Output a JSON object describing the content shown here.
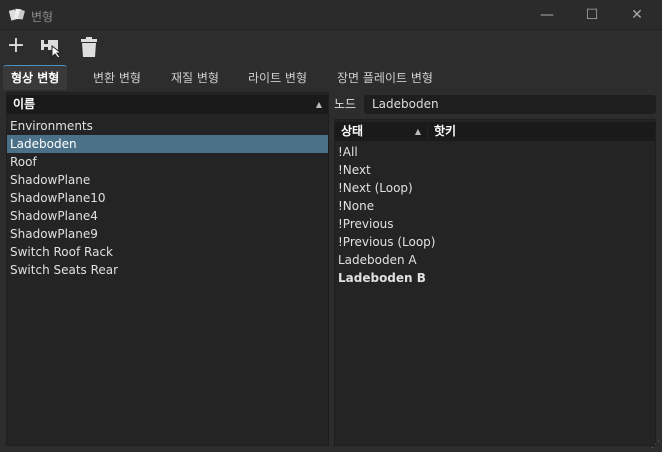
{
  "window": {
    "title": "변형",
    "minimize": "—",
    "maximize": "☐",
    "close": "✕"
  },
  "toolbar": {
    "add": "add-icon",
    "pick": "pick-node-icon",
    "delete": "trash-icon"
  },
  "tabs": [
    "형상 변형",
    "변환 변형",
    "재질 변형",
    "라이트 변형",
    "장면 플레이트 변형"
  ],
  "left": {
    "header": "이름",
    "items": [
      "Environments",
      "Ladeboden",
      "Roof",
      "ShadowPlane",
      "ShadowPlane10",
      "ShadowPlane4",
      "ShadowPlane9",
      "Switch Roof Rack",
      "Switch Seats Rear"
    ],
    "selected": 1
  },
  "right": {
    "node_label": "노드",
    "node_value": "Ladeboden",
    "col_state": "상태",
    "col_hotkey": "핫키",
    "states": [
      "!All",
      "!Next",
      "!Next (Loop)",
      "!None",
      "!Previous",
      "!Previous (Loop)",
      "Ladeboden A",
      "Ladeboden B"
    ],
    "active": 7
  }
}
